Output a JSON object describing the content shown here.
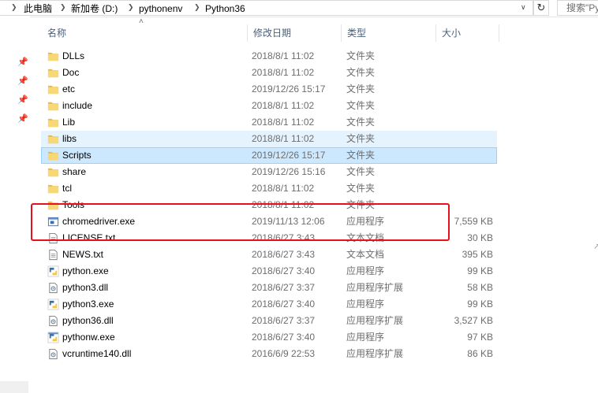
{
  "address": {
    "crumbs": [
      "此电脑",
      "新加卷 (D:)",
      "pythonenv",
      "Python36"
    ],
    "search_placeholder": "搜索\"Py",
    "refresh_icon": "refresh-icon"
  },
  "columns": {
    "name": "名称",
    "date": "修改日期",
    "type": "类型",
    "size": "大小"
  },
  "files": [
    {
      "name": "DLLs",
      "date": "2018/8/1 11:02",
      "type": "文件夹",
      "size": "",
      "icon": "folder"
    },
    {
      "name": "Doc",
      "date": "2018/8/1 11:02",
      "type": "文件夹",
      "size": "",
      "icon": "folder"
    },
    {
      "name": "etc",
      "date": "2019/12/26 15:17",
      "type": "文件夹",
      "size": "",
      "icon": "folder"
    },
    {
      "name": "include",
      "date": "2018/8/1 11:02",
      "type": "文件夹",
      "size": "",
      "icon": "folder"
    },
    {
      "name": "Lib",
      "date": "2018/8/1 11:02",
      "type": "文件夹",
      "size": "",
      "icon": "folder"
    },
    {
      "name": "libs",
      "date": "2018/8/1 11:02",
      "type": "文件夹",
      "size": "",
      "icon": "folder",
      "state": "hover"
    },
    {
      "name": "Scripts",
      "date": "2019/12/26 15:17",
      "type": "文件夹",
      "size": "",
      "icon": "folder",
      "state": "selected"
    },
    {
      "name": "share",
      "date": "2019/12/26 15:16",
      "type": "文件夹",
      "size": "",
      "icon": "folder"
    },
    {
      "name": "tcl",
      "date": "2018/8/1 11:02",
      "type": "文件夹",
      "size": "",
      "icon": "folder"
    },
    {
      "name": "Tools",
      "date": "2018/8/1 11:02",
      "type": "文件夹",
      "size": "",
      "icon": "folder"
    },
    {
      "name": "chromedriver.exe",
      "date": "2019/11/13 12:06",
      "type": "应用程序",
      "size": "7,559 KB",
      "icon": "exe"
    },
    {
      "name": "LICENSE.txt",
      "date": "2018/6/27 3:43",
      "type": "文本文档",
      "size": "30 KB",
      "icon": "txt"
    },
    {
      "name": "NEWS.txt",
      "date": "2018/6/27 3:43",
      "type": "文本文档",
      "size": "395 KB",
      "icon": "txt"
    },
    {
      "name": "python.exe",
      "date": "2018/6/27 3:40",
      "type": "应用程序",
      "size": "99 KB",
      "icon": "python"
    },
    {
      "name": "python3.dll",
      "date": "2018/6/27 3:37",
      "type": "应用程序扩展",
      "size": "58 KB",
      "icon": "dll"
    },
    {
      "name": "python3.exe",
      "date": "2018/6/27 3:40",
      "type": "应用程序",
      "size": "99 KB",
      "icon": "python"
    },
    {
      "name": "python36.dll",
      "date": "2018/6/27 3:37",
      "type": "应用程序扩展",
      "size": "3,527 KB",
      "icon": "dll"
    },
    {
      "name": "pythonw.exe",
      "date": "2018/6/27 3:40",
      "type": "应用程序",
      "size": "97 KB",
      "icon": "pythonw"
    },
    {
      "name": "vcruntime140.dll",
      "date": "2016/6/9 22:53",
      "type": "应用程序扩展",
      "size": "86 KB",
      "icon": "dll"
    }
  ],
  "colors": {
    "folder": "#f8d775",
    "selected_bg": "#cce8ff",
    "hover_bg": "#e5f3ff",
    "highlight_box": "#e8101a"
  }
}
